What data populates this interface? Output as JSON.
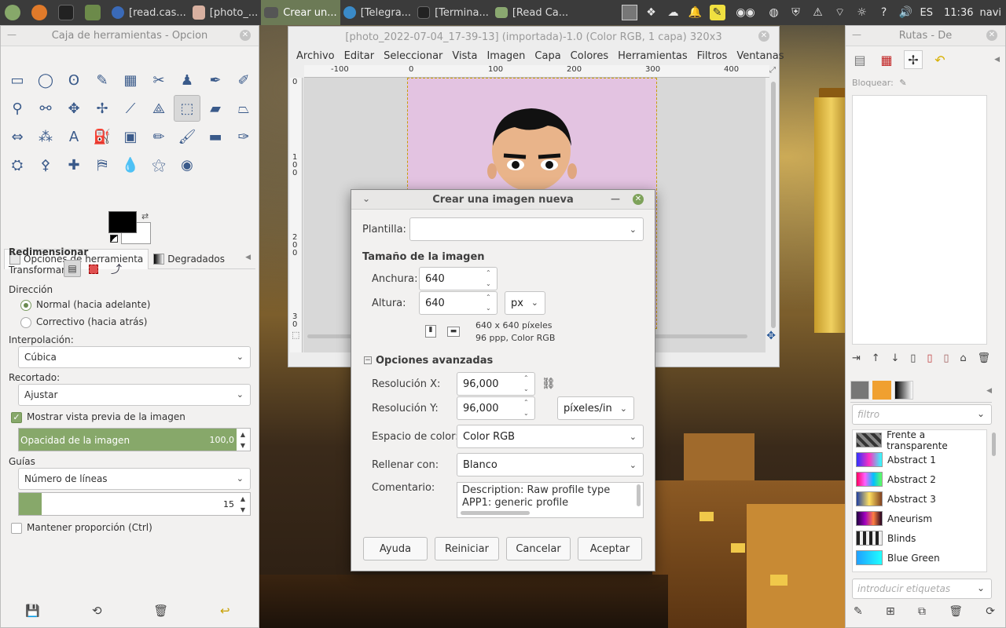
{
  "topbar": {
    "items": [
      {
        "label": "",
        "color": "#87a86a"
      },
      {
        "label": "",
        "color": "#e07a2a"
      },
      {
        "label": "",
        "color": "#2a2a2a"
      },
      {
        "label": "",
        "color": "#6c8a4a"
      },
      {
        "label": "[read.cas...",
        "color": "#3a6ab8"
      },
      {
        "label": "[photo_...",
        "color": "#d8b0a0"
      },
      {
        "label": "Crear un...",
        "color": "#6a6a6a"
      },
      {
        "label": "[Telegra...",
        "color": "#3a8ac8"
      },
      {
        "label": "[Termina...",
        "color": "#2a2a2a"
      },
      {
        "label": "[Read Ca...",
        "color": "#8aa870"
      }
    ],
    "lang": "ES",
    "time": "11:36",
    "user": "navi"
  },
  "toolbox": {
    "title": "Caja de herramientas - Opcion",
    "tools": [
      "▭",
      "◯",
      "ʘ",
      "✎",
      "▦",
      "✂",
      "♟",
      "✒",
      "✐",
      "⚲",
      "⚯",
      "✥",
      "✢",
      "⟋",
      "⟁",
      "⬚",
      "▰",
      "⏢",
      "⇔",
      "⁂",
      "A",
      "⛽",
      "▣",
      "✏",
      "🖌",
      "▬",
      "✑",
      "⛭",
      "⚴",
      "✚",
      "⛿",
      "💧",
      "⚝",
      "◉"
    ],
    "tab_options": "Opciones de herramienta",
    "tab_gradients": "Degradados",
    "tool_name": "Redimensionar",
    "transform_label": "Transformar:",
    "direction_label": "Dirección",
    "direction_normal": "Normal (hacia adelante)",
    "direction_corrective": "Correctivo (hacia atrás)",
    "interp_label": "Interpolación:",
    "interp_value": "Cúbica",
    "clip_label": "Recortado:",
    "clip_value": "Ajustar",
    "preview_label": "Mostrar vista previa de la imagen",
    "opacity_label": "Opacidad de la imagen",
    "opacity_value": "100,0",
    "guides_label": "Guías",
    "guides_value": "Número de líneas",
    "lines_value": "15",
    "keep_ratio": "Mantener proporción  (Ctrl)"
  },
  "imagewin": {
    "title": "[photo_2022-07-04_17-39-13] (importada)-1.0 (Color RGB, 1 capa) 320x3",
    "menu": [
      "Archivo",
      "Editar",
      "Seleccionar",
      "Vista",
      "Imagen",
      "Capa",
      "Colores",
      "Herramientas",
      "Filtros",
      "Ventanas"
    ],
    "ruler_h": [
      "-100",
      "0",
      "100",
      "200",
      "300",
      "400"
    ],
    "ruler_v": [
      "0",
      "1\n0\n0",
      "2\n0\n0",
      "3\n0"
    ]
  },
  "dialog": {
    "title": "Crear una imagen nueva",
    "template_label": "Plantilla:",
    "template_value": "",
    "size_header": "Tamaño de la imagen",
    "width_label": "Anchura:",
    "width_value": "640",
    "height_label": "Altura:",
    "height_value": "640",
    "unit": "px",
    "info_size": "640 x 640 píxeles",
    "info_res": "96 ppp, Color RGB",
    "advanced": "Opciones avanzadas",
    "resx_label": "Resolución X:",
    "resx_value": "96,000",
    "resy_label": "Resolución Y:",
    "resy_value": "96,000",
    "res_unit": "píxeles/in",
    "colorspace_label": "Espacio de color:",
    "colorspace_value": "Color RGB",
    "fill_label": "Rellenar con:",
    "fill_value": "Blanco",
    "comment_label": "Comentario:",
    "comment_value": "Description: Raw profile type APP1: generic profile",
    "btn_help": "Ayuda",
    "btn_reset": "Reiniciar",
    "btn_cancel": "Cancelar",
    "btn_ok": "Aceptar"
  },
  "dock": {
    "title": "Rutas - De",
    "lock_label": "Bloquear:",
    "filter_placeholder": "filtro",
    "tags_placeholder": "introducir etiquetas",
    "gradients": [
      {
        "name": "Frente a transparente",
        "css": "repeating-linear-gradient(45deg,#333 0 4px,#888 4px 8px)"
      },
      {
        "name": "Abstract 1",
        "css": "linear-gradient(90deg,#3030ff,#ff30c0,#30ffff)"
      },
      {
        "name": "Abstract 2",
        "css": "linear-gradient(90deg,#ff0060,#ff60ff,#00c0ff,#60ff60)"
      },
      {
        "name": "Abstract 3",
        "css": "linear-gradient(90deg,#2040a0,#ffe060,#804020)"
      },
      {
        "name": "Aneurism",
        "css": "linear-gradient(90deg,#200040,#a000c0,#ff8040,#200020)"
      },
      {
        "name": "Blinds",
        "css": "repeating-linear-gradient(90deg,#222 0 4px,#eee 4px 8px)"
      },
      {
        "name": "Blue Green",
        "css": "linear-gradient(90deg,#20a0ff,#20ffff)"
      }
    ]
  }
}
